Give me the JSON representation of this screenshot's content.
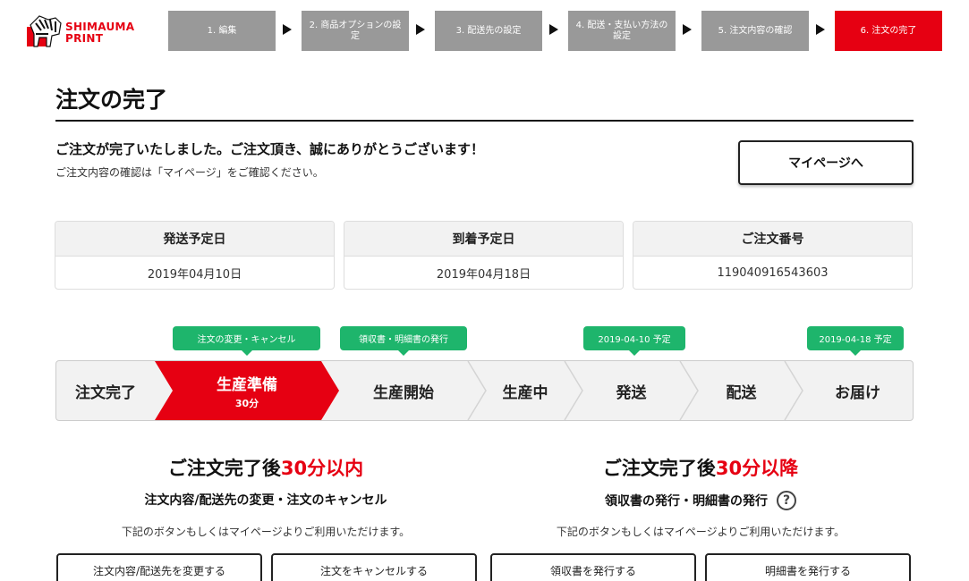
{
  "header": {
    "logo_line1": "SHIMAUMA",
    "logo_line2": "PRINT",
    "steps": [
      {
        "label": "1. 編集"
      },
      {
        "label": "2. 商品オプションの設定"
      },
      {
        "label": "3. 配送先の設定"
      },
      {
        "label": "4. 配送・支払い方法の設定"
      },
      {
        "label": "5. 注文内容の確認"
      },
      {
        "label": "6. 注文の完了"
      }
    ],
    "active_step": 6,
    "brand_color": "#e60012",
    "inactive_color": "#999999"
  },
  "page": {
    "title": "注文の完了",
    "thanks": "ご注文が完了いたしました。ご注文頂き、誠にありがとうございます！",
    "confirm_note": "ご注文内容の確認は「マイページ」をご確認ください。",
    "mypage_button": "マイページへ"
  },
  "info": [
    {
      "label": "発送予定日",
      "value": "2019年04月10日"
    },
    {
      "label": "到着予定日",
      "value": "2019年04月18日"
    },
    {
      "label": "ご注文番号",
      "value": "119040916543603"
    }
  ],
  "tags": [
    {
      "text": "注文の変更・キャンセル"
    },
    {
      "text": "領収書・明細書の発行"
    },
    {
      "text": "2019-04-10 予定"
    },
    {
      "text": "2019-04-18 予定"
    }
  ],
  "progress": {
    "stages": [
      {
        "label": "注文完了"
      },
      {
        "label": "生産準備",
        "sub": "30分"
      },
      {
        "label": "生産開始"
      },
      {
        "label": "生産中"
      },
      {
        "label": "発送"
      },
      {
        "label": "配送"
      },
      {
        "label": "お届け"
      }
    ],
    "current_index": 1,
    "accent_color": "#e60012",
    "tag_color": "#1eb56c"
  },
  "sections": {
    "left": {
      "title_prefix": "ご注文完了後",
      "title_highlight": "30分以内",
      "subtitle": "注文内容/配送先の変更・注文のキャンセル",
      "note": "下記のボタンもしくはマイページよりご利用いただけます。",
      "buttons": [
        "注文内容/配送先を変更する",
        "注文をキャンセルする"
      ]
    },
    "right": {
      "title_prefix": "ご注文完了後",
      "title_highlight": "30分以降",
      "subtitle": "領収書の発行・明細書の発行",
      "help_icon": "?",
      "note": "下記のボタンもしくはマイページよりご利用いただけます。",
      "buttons": [
        "領収書を発行する",
        "明細書を発行する"
      ]
    }
  }
}
